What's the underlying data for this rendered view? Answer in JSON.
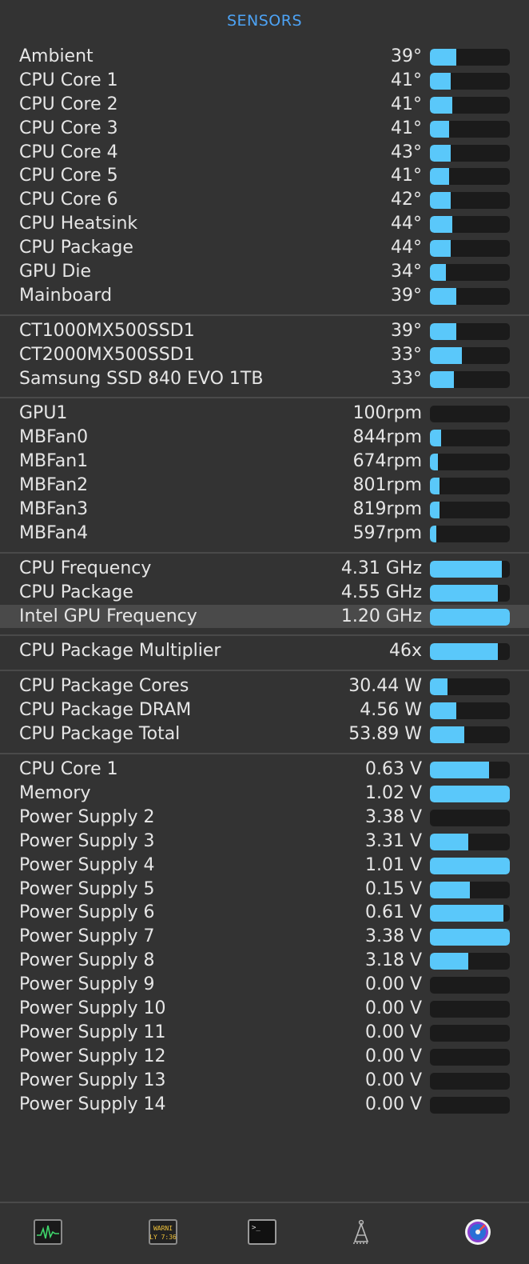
{
  "header": {
    "title": "SENSORS"
  },
  "groups": [
    {
      "rows": [
        {
          "label": "Ambient",
          "value": "39°",
          "level": 0.33
        },
        {
          "label": "CPU Core 1",
          "value": "41°",
          "level": 0.26
        },
        {
          "label": "CPU Core 2",
          "value": "41°",
          "level": 0.28
        },
        {
          "label": "CPU Core 3",
          "value": "41°",
          "level": 0.24
        },
        {
          "label": "CPU Core 4",
          "value": "43°",
          "level": 0.26
        },
        {
          "label": "CPU Core 5",
          "value": "41°",
          "level": 0.24
        },
        {
          "label": "CPU Core 6",
          "value": "42°",
          "level": 0.26
        },
        {
          "label": "CPU Heatsink",
          "value": "44°",
          "level": 0.28
        },
        {
          "label": "CPU Package",
          "value": "44°",
          "level": 0.26
        },
        {
          "label": "GPU Die",
          "value": "34°",
          "level": 0.2
        },
        {
          "label": "Mainboard",
          "value": "39°",
          "level": 0.33
        }
      ]
    },
    {
      "rows": [
        {
          "label": "CT1000MX500SSD1",
          "value": "39°",
          "level": 0.33
        },
        {
          "label": "CT2000MX500SSD1",
          "value": "33°",
          "level": 0.4
        },
        {
          "label": "Samsung SSD 840 EVO 1TB",
          "value": "33°",
          "level": 0.3
        }
      ]
    },
    {
      "rows": [
        {
          "label": "GPU1",
          "value": "100rpm",
          "level": 0
        },
        {
          "label": "MBFan0",
          "value": "844rpm",
          "level": 0.14
        },
        {
          "label": "MBFan1",
          "value": "674rpm",
          "level": 0.1
        },
        {
          "label": "MBFan2",
          "value": "801rpm",
          "level": 0.12
        },
        {
          "label": "MBFan3",
          "value": "819rpm",
          "level": 0.12
        },
        {
          "label": "MBFan4",
          "value": "597rpm",
          "level": 0.08
        }
      ]
    },
    {
      "rows": [
        {
          "label": "CPU Frequency",
          "value": "4.31 GHz",
          "level": 0.9
        },
        {
          "label": "CPU Package",
          "value": "4.55 GHz",
          "level": 0.85
        },
        {
          "label": "Intel GPU Frequency",
          "value": "1.20 GHz",
          "level": 1.0,
          "highlight": true
        }
      ]
    },
    {
      "rows": [
        {
          "label": "CPU Package Multiplier",
          "value": "46x",
          "level": 0.85
        }
      ]
    },
    {
      "rows": [
        {
          "label": "CPU Package Cores",
          "value": "30.44 W",
          "level": 0.22
        },
        {
          "label": "CPU Package DRAM",
          "value": "4.56 W",
          "level": 0.33
        },
        {
          "label": "CPU Package Total",
          "value": "53.89 W",
          "level": 0.43
        }
      ]
    },
    {
      "rows": [
        {
          "label": "CPU Core 1",
          "value": "0.63 V",
          "level": 0.74
        },
        {
          "label": "Memory",
          "value": "1.02 V",
          "level": 1.0
        },
        {
          "label": "Power Supply 2",
          "value": "3.38 V",
          "level": 0
        },
        {
          "label": "Power Supply 3",
          "value": "3.31 V",
          "level": 0.48
        },
        {
          "label": "Power Supply 4",
          "value": "1.01 V",
          "level": 1.0
        },
        {
          "label": "Power Supply 5",
          "value": "0.15 V",
          "level": 0.5
        },
        {
          "label": "Power Supply 6",
          "value": "0.61 V",
          "level": 0.92
        },
        {
          "label": "Power Supply 7",
          "value": "3.38 V",
          "level": 1.0
        },
        {
          "label": "Power Supply 8",
          "value": "3.18 V",
          "level": 0.48
        },
        {
          "label": "Power Supply 9",
          "value": "0.00 V",
          "level": 0
        },
        {
          "label": "Power Supply 10",
          "value": "0.00 V",
          "level": 0
        },
        {
          "label": "Power Supply 11",
          "value": "0.00 V",
          "level": 0
        },
        {
          "label": "Power Supply 12",
          "value": "0.00 V",
          "level": 0
        },
        {
          "label": "Power Supply 13",
          "value": "0.00 V",
          "level": 0
        },
        {
          "label": "Power Supply 14",
          "value": "0.00 V",
          "level": 0
        }
      ]
    }
  ],
  "footer": {
    "icons": [
      "activity-monitor-icon",
      "console-warning-icon",
      "terminal-icon",
      "script-editor-icon",
      "istat-menus-icon"
    ],
    "console_text_1": "WARNI",
    "console_text_2": "LY 7:36"
  },
  "colors": {
    "accent": "#4da3f5",
    "bar_fill": "#5ac8fa",
    "bar_track": "#1b1b1b",
    "background": "#333333"
  }
}
